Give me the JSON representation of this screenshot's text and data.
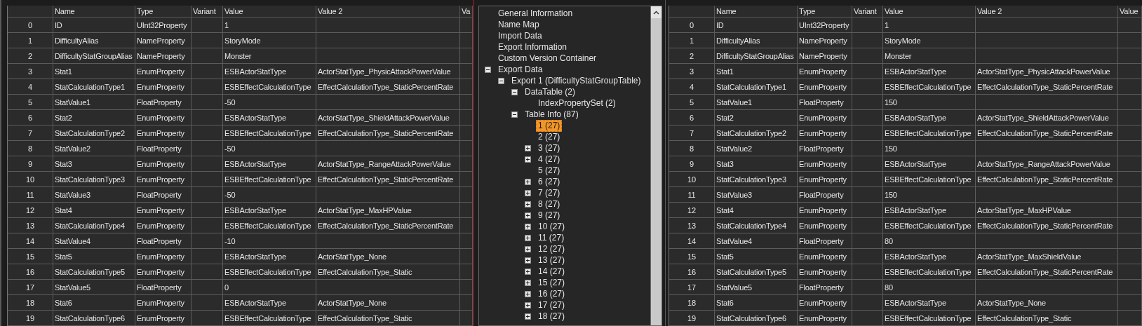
{
  "left_table": {
    "columns": [
      "Name",
      "Type",
      "Variant",
      "Value",
      "Value 2",
      "Va"
    ],
    "rows": [
      {
        "index": "0",
        "name": "ID",
        "type": "UInt32Property",
        "value": "1"
      },
      {
        "index": "1",
        "name": "DifficultyAlias",
        "type": "NameProperty",
        "value": "StoryMode"
      },
      {
        "index": "2",
        "name": "DifficultyStatGroupAlias",
        "type": "NameProperty",
        "value": "Monster"
      },
      {
        "index": "3",
        "name": "Stat1",
        "type": "EnumProperty",
        "value": "ESBActorStatType",
        "value_2": "ActorStatType_PhysicAttackPowerValue"
      },
      {
        "index": "4",
        "name": "StatCalculationType1",
        "type": "EnumProperty",
        "value": "ESBEffectCalculationType",
        "value_2": "EffectCalculationType_StaticPercentRate"
      },
      {
        "index": "5",
        "name": "StatValue1",
        "type": "FloatProperty",
        "value": "-50"
      },
      {
        "index": "6",
        "name": "Stat2",
        "type": "EnumProperty",
        "value": "ESBActorStatType",
        "value_2": "ActorStatType_ShieldAttackPowerValue"
      },
      {
        "index": "7",
        "name": "StatCalculationType2",
        "type": "EnumProperty",
        "value": "ESBEffectCalculationType",
        "value_2": "EffectCalculationType_StaticPercentRate"
      },
      {
        "index": "8",
        "name": "StatValue2",
        "type": "FloatProperty",
        "value": "-50"
      },
      {
        "index": "9",
        "name": "Stat3",
        "type": "EnumProperty",
        "value": "ESBActorStatType",
        "value_2": "ActorStatType_RangeAttackPowerValue"
      },
      {
        "index": "10",
        "name": "StatCalculationType3",
        "type": "EnumProperty",
        "value": "ESBEffectCalculationType",
        "value_2": "EffectCalculationType_StaticPercentRate"
      },
      {
        "index": "11",
        "name": "StatValue3",
        "type": "FloatProperty",
        "value": "-50"
      },
      {
        "index": "12",
        "name": "Stat4",
        "type": "EnumProperty",
        "value": "ESBActorStatType",
        "value_2": "ActorStatType_MaxHPValue"
      },
      {
        "index": "13",
        "name": "StatCalculationType4",
        "type": "EnumProperty",
        "value": "ESBEffectCalculationType",
        "value_2": "EffectCalculationType_StaticPercentRate"
      },
      {
        "index": "14",
        "name": "StatValue4",
        "type": "FloatProperty",
        "value": "-10"
      },
      {
        "index": "15",
        "name": "Stat5",
        "type": "EnumProperty",
        "value": "ESBActorStatType",
        "value_2": "ActorStatType_None"
      },
      {
        "index": "16",
        "name": "StatCalculationType5",
        "type": "EnumProperty",
        "value": "ESBEffectCalculationType",
        "value_2": "EffectCalculationType_Static"
      },
      {
        "index": "17",
        "name": "StatValue5",
        "type": "FloatProperty",
        "value": "0"
      },
      {
        "index": "18",
        "name": "Stat6",
        "type": "EnumProperty",
        "value": "ESBActorStatType",
        "value_2": "ActorStatType_None"
      },
      {
        "index": "19",
        "name": "StatCalculationType6",
        "type": "EnumProperty",
        "value": "ESBEffectCalculationType",
        "value_2": "EffectCalculationType_Static"
      }
    ]
  },
  "tree": [
    {
      "label": "General Information",
      "selected": false
    },
    {
      "label": "Name Map",
      "selected": false
    },
    {
      "label": "Import Data",
      "selected": false
    },
    {
      "label": "Export Information",
      "selected": false
    },
    {
      "label": "Custom Version Container",
      "selected": false
    },
    {
      "label": "Export Data",
      "selected": false,
      "expanded": true,
      "children": [
        {
          "label": "Export 1 (DifficultyStatGroupTable)",
          "selected": false,
          "expanded": true,
          "children": [
            {
              "label": "DataTable (2)",
              "selected": false,
              "expanded": true,
              "children": [
                {
                  "label": "IndexPropertySet (2)",
                  "selected": false
                }
              ]
            },
            {
              "label": "Table Info (87)",
              "selected": false,
              "expanded": true,
              "children": [
                {
                  "label": "1 (27)",
                  "selected": true
                },
                {
                  "label": "2 (27)",
                  "selected": false
                },
                {
                  "label": "3 (27)",
                  "selected": false,
                  "expanded": false
                },
                {
                  "label": "4 (27)",
                  "selected": false,
                  "expanded": false
                },
                {
                  "label": "5 (27)",
                  "selected": false
                },
                {
                  "label": "6 (27)",
                  "selected": false,
                  "expanded": false
                },
                {
                  "label": "7 (27)",
                  "selected": false,
                  "expanded": false
                },
                {
                  "label": "8 (27)",
                  "selected": false,
                  "expanded": false
                },
                {
                  "label": "9 (27)",
                  "selected": false,
                  "expanded": false
                },
                {
                  "label": "10 (27)",
                  "selected": false,
                  "expanded": false
                },
                {
                  "label": "11 (27)",
                  "selected": false,
                  "expanded": false
                },
                {
                  "label": "12 (27)",
                  "selected": false,
                  "expanded": false
                },
                {
                  "label": "13 (27)",
                  "selected": false,
                  "expanded": false
                },
                {
                  "label": "14 (27)",
                  "selected": false,
                  "expanded": false
                },
                {
                  "label": "15 (27)",
                  "selected": false,
                  "expanded": false
                },
                {
                  "label": "16 (27)",
                  "selected": false,
                  "expanded": false
                },
                {
                  "label": "17 (27)",
                  "selected": false,
                  "expanded": false
                },
                {
                  "label": "18 (27)",
                  "selected": false,
                  "expanded": false
                }
              ]
            }
          ]
        }
      ]
    }
  ],
  "right_table": {
    "columns": [
      "Name",
      "Type",
      "Variant",
      "Value",
      "Value 2",
      "Value"
    ],
    "rows": [
      {
        "index": "0",
        "name": "ID",
        "type": "UInt32Property",
        "value": "1"
      },
      {
        "index": "1",
        "name": "DifficultyAlias",
        "type": "NameProperty",
        "value": "StoryMode"
      },
      {
        "index": "2",
        "name": "DifficultyStatGroupAlias",
        "type": "NameProperty",
        "value": "Monster"
      },
      {
        "index": "3",
        "name": "Stat1",
        "type": "EnumProperty",
        "value": "ESBActorStatType",
        "value_2": "ActorStatType_PhysicAttackPowerValue"
      },
      {
        "index": "4",
        "name": "StatCalculationType1",
        "type": "EnumProperty",
        "value": "ESBEffectCalculationType",
        "value_2": "EffectCalculationType_StaticPercentRate"
      },
      {
        "index": "5",
        "name": "StatValue1",
        "type": "FloatProperty",
        "value": "150"
      },
      {
        "index": "6",
        "name": "Stat2",
        "type": "EnumProperty",
        "value": "ESBActorStatType",
        "value_2": "ActorStatType_ShieldAttackPowerValue"
      },
      {
        "index": "7",
        "name": "StatCalculationType2",
        "type": "EnumProperty",
        "value": "ESBEffectCalculationType",
        "value_2": "EffectCalculationType_StaticPercentRate"
      },
      {
        "index": "8",
        "name": "StatValue2",
        "type": "FloatProperty",
        "value": "150"
      },
      {
        "index": "9",
        "name": "Stat3",
        "type": "EnumProperty",
        "value": "ESBActorStatType",
        "value_2": "ActorStatType_RangeAttackPowerValue"
      },
      {
        "index": "10",
        "name": "StatCalculationType3",
        "type": "EnumProperty",
        "value": "ESBEffectCalculationType",
        "value_2": "EffectCalculationType_StaticPercentRate"
      },
      {
        "index": "11",
        "name": "StatValue3",
        "type": "FloatProperty",
        "value": "150"
      },
      {
        "index": "12",
        "name": "Stat4",
        "type": "EnumProperty",
        "value": "ESBActorStatType",
        "value_2": "ActorStatType_MaxHPValue"
      },
      {
        "index": "13",
        "name": "StatCalculationType4",
        "type": "EnumProperty",
        "value": "ESBEffectCalculationType",
        "value_2": "EffectCalculationType_StaticPercentRate"
      },
      {
        "index": "14",
        "name": "StatValue4",
        "type": "FloatProperty",
        "value": "80"
      },
      {
        "index": "15",
        "name": "Stat5",
        "type": "EnumProperty",
        "value": "ESBActorStatType",
        "value_2": "ActorStatType_MaxShieldValue"
      },
      {
        "index": "16",
        "name": "StatCalculationType5",
        "type": "EnumProperty",
        "value": "ESBEffectCalculationType",
        "value_2": "EffectCalculationType_StaticPercentRate"
      },
      {
        "index": "17",
        "name": "StatValue5",
        "type": "FloatProperty",
        "value": "80"
      },
      {
        "index": "18",
        "name": "Stat6",
        "type": "EnumProperty",
        "value": "ESBActorStatType",
        "value_2": "ActorStatType_None"
      },
      {
        "index": "19",
        "name": "StatCalculationType6",
        "type": "EnumProperty",
        "value": "ESBEffectCalculationType",
        "value_2": "EffectCalculationType_Static"
      }
    ]
  }
}
